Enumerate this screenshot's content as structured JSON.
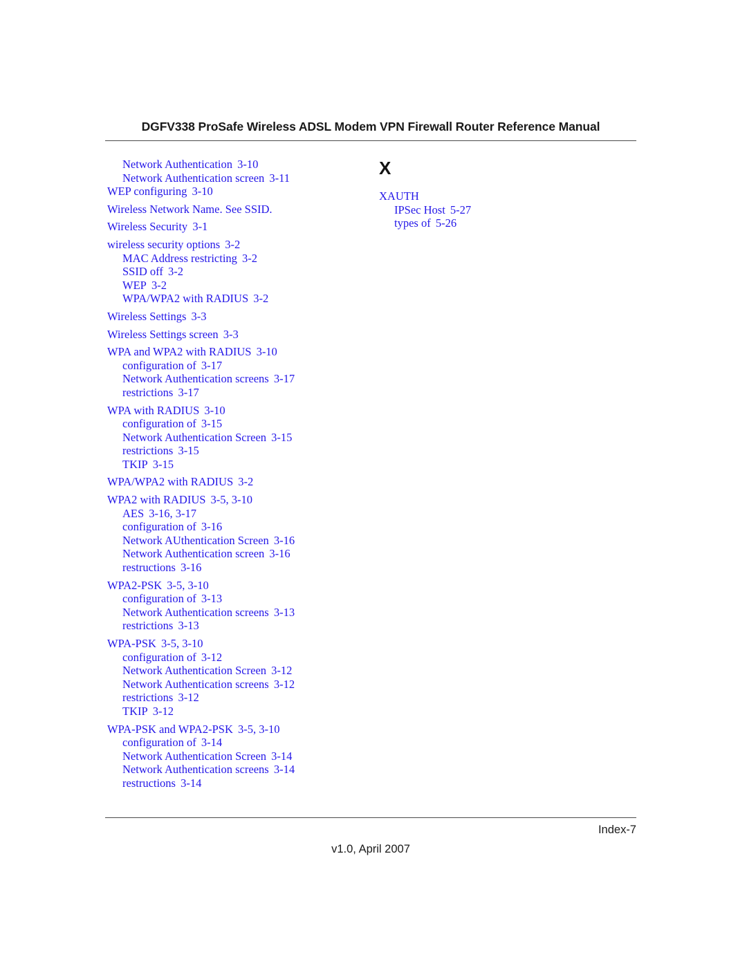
{
  "header": {
    "title": "DGFV338 ProSafe Wireless ADSL Modem VPN Firewall Router Reference Manual"
  },
  "footer": {
    "folio": "Index-7",
    "version": "v1.0, April 2007"
  },
  "index": {
    "columns": [
      {
        "heading": null,
        "entries": [
          {
            "level": 1,
            "text": "Network Authentication",
            "pages": "3-10"
          },
          {
            "level": 1,
            "text": "Network Authentication screen",
            "pages": "3-11"
          },
          {
            "level": 0,
            "text": "WEP configuring",
            "pages": "3-10"
          },
          {
            "level": 0,
            "text": "Wireless Network Name. See SSID.",
            "pages": ""
          },
          {
            "level": 0,
            "text": "Wireless Security",
            "pages": "3-1"
          },
          {
            "level": 0,
            "text": "wireless security options",
            "pages": "3-2"
          },
          {
            "level": 1,
            "text": "MAC Address restricting",
            "pages": "3-2"
          },
          {
            "level": 1,
            "text": "SSID off",
            "pages": "3-2"
          },
          {
            "level": 1,
            "text": "WEP",
            "pages": "3-2"
          },
          {
            "level": 1,
            "text": "WPA/WPA2 with RADIUS",
            "pages": "3-2"
          },
          {
            "level": 0,
            "text": "Wireless Settings",
            "pages": "3-3"
          },
          {
            "level": 0,
            "text": "Wireless Settings screen",
            "pages": "3-3"
          },
          {
            "level": 0,
            "text": "WPA and WPA2 with RADIUS",
            "pages": "3-10"
          },
          {
            "level": 1,
            "text": "configuration of",
            "pages": "3-17"
          },
          {
            "level": 1,
            "text": "Network Authentication screens",
            "pages": "3-17"
          },
          {
            "level": 1,
            "text": "restrictions",
            "pages": "3-17"
          },
          {
            "level": 0,
            "text": "WPA with RADIUS",
            "pages": "3-10"
          },
          {
            "level": 1,
            "text": "configuration of",
            "pages": "3-15"
          },
          {
            "level": 1,
            "text": "Network Authentication Screen",
            "pages": "3-15"
          },
          {
            "level": 1,
            "text": "restrictions",
            "pages": "3-15"
          },
          {
            "level": 1,
            "text": "TKIP",
            "pages": "3-15"
          },
          {
            "level": 0,
            "text": "WPA/WPA2 with RADIUS",
            "pages": "3-2"
          },
          {
            "level": 0,
            "text": "WPA2 with RADIUS",
            "pages": "3-5, 3-10"
          },
          {
            "level": 1,
            "text": "AES",
            "pages": "3-16, 3-17"
          },
          {
            "level": 1,
            "text": "configuration of",
            "pages": "3-16"
          },
          {
            "level": 1,
            "text": "Network AUthentication Screen",
            "pages": "3-16"
          },
          {
            "level": 1,
            "text": "Network Authentication screen",
            "pages": "3-16"
          },
          {
            "level": 1,
            "text": "restructions",
            "pages": "3-16"
          },
          {
            "level": 0,
            "text": "WPA2-PSK",
            "pages": "3-5, 3-10"
          },
          {
            "level": 1,
            "text": "configuration of",
            "pages": "3-13"
          },
          {
            "level": 1,
            "text": "Network Authentication screens",
            "pages": "3-13"
          },
          {
            "level": 1,
            "text": "restrictions",
            "pages": "3-13"
          },
          {
            "level": 0,
            "text": "WPA-PSK",
            "pages": "3-5, 3-10"
          },
          {
            "level": 1,
            "text": "configuration of",
            "pages": "3-12"
          },
          {
            "level": 1,
            "text": "Network Authentication Screen",
            "pages": "3-12"
          },
          {
            "level": 1,
            "text": "Network Authentication screens",
            "pages": "3-12"
          },
          {
            "level": 1,
            "text": "restrictions",
            "pages": "3-12"
          },
          {
            "level": 1,
            "text": "TKIP",
            "pages": "3-12"
          },
          {
            "level": 0,
            "text": "WPA-PSK and WPA2-PSK",
            "pages": "3-5, 3-10"
          },
          {
            "level": 1,
            "text": "configuration of",
            "pages": "3-14"
          },
          {
            "level": 1,
            "text": "Network Authentication Screen",
            "pages": "3-14"
          },
          {
            "level": 1,
            "text": "Network Authentication screens",
            "pages": "3-14"
          },
          {
            "level": 1,
            "text": "restructions",
            "pages": "3-14"
          }
        ]
      },
      {
        "heading": "X",
        "entries": [
          {
            "level": 0,
            "text": "XAUTH",
            "pages": ""
          },
          {
            "level": 1,
            "text": "IPSec Host",
            "pages": "5-27"
          },
          {
            "level": 1,
            "text": "types of",
            "pages": "5-26"
          }
        ]
      }
    ]
  },
  "colors": {
    "link_blue": "#2417e8",
    "text_black": "#1a1a1a",
    "rule_gray": "#4a4a4a"
  }
}
